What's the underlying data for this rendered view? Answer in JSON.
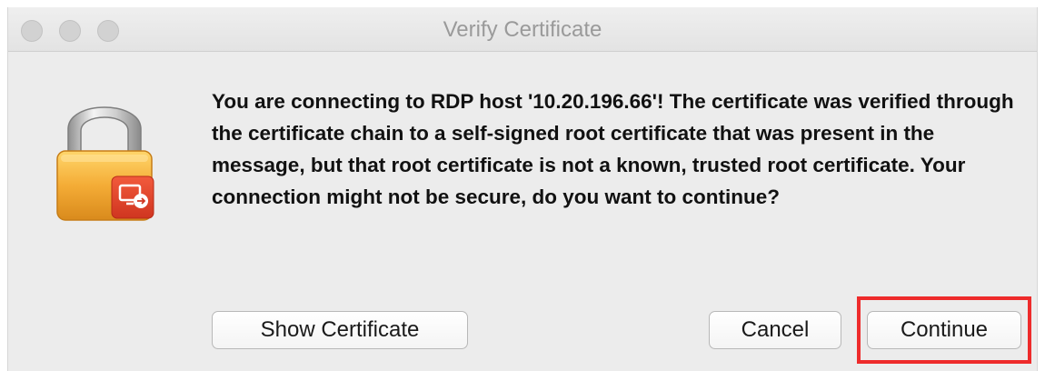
{
  "window": {
    "title": "Verify Certificate"
  },
  "dialog": {
    "icon": "lock-remote-desktop-icon",
    "message": "You are connecting to RDP host '10.20.196.66'! The certificate was verified through the certificate chain to a self-signed root certificate that was present in the message, but that root certificate is not a known, trusted root certificate. Your connection might not be secure, do you want to continue?"
  },
  "buttons": {
    "show_certificate": "Show Certificate",
    "cancel": "Cancel",
    "continue": "Continue"
  },
  "colors": {
    "window_bg": "#ececec",
    "highlight": "#ee2b2b",
    "lock_body": "#f2a634",
    "badge": "#e2412c"
  }
}
